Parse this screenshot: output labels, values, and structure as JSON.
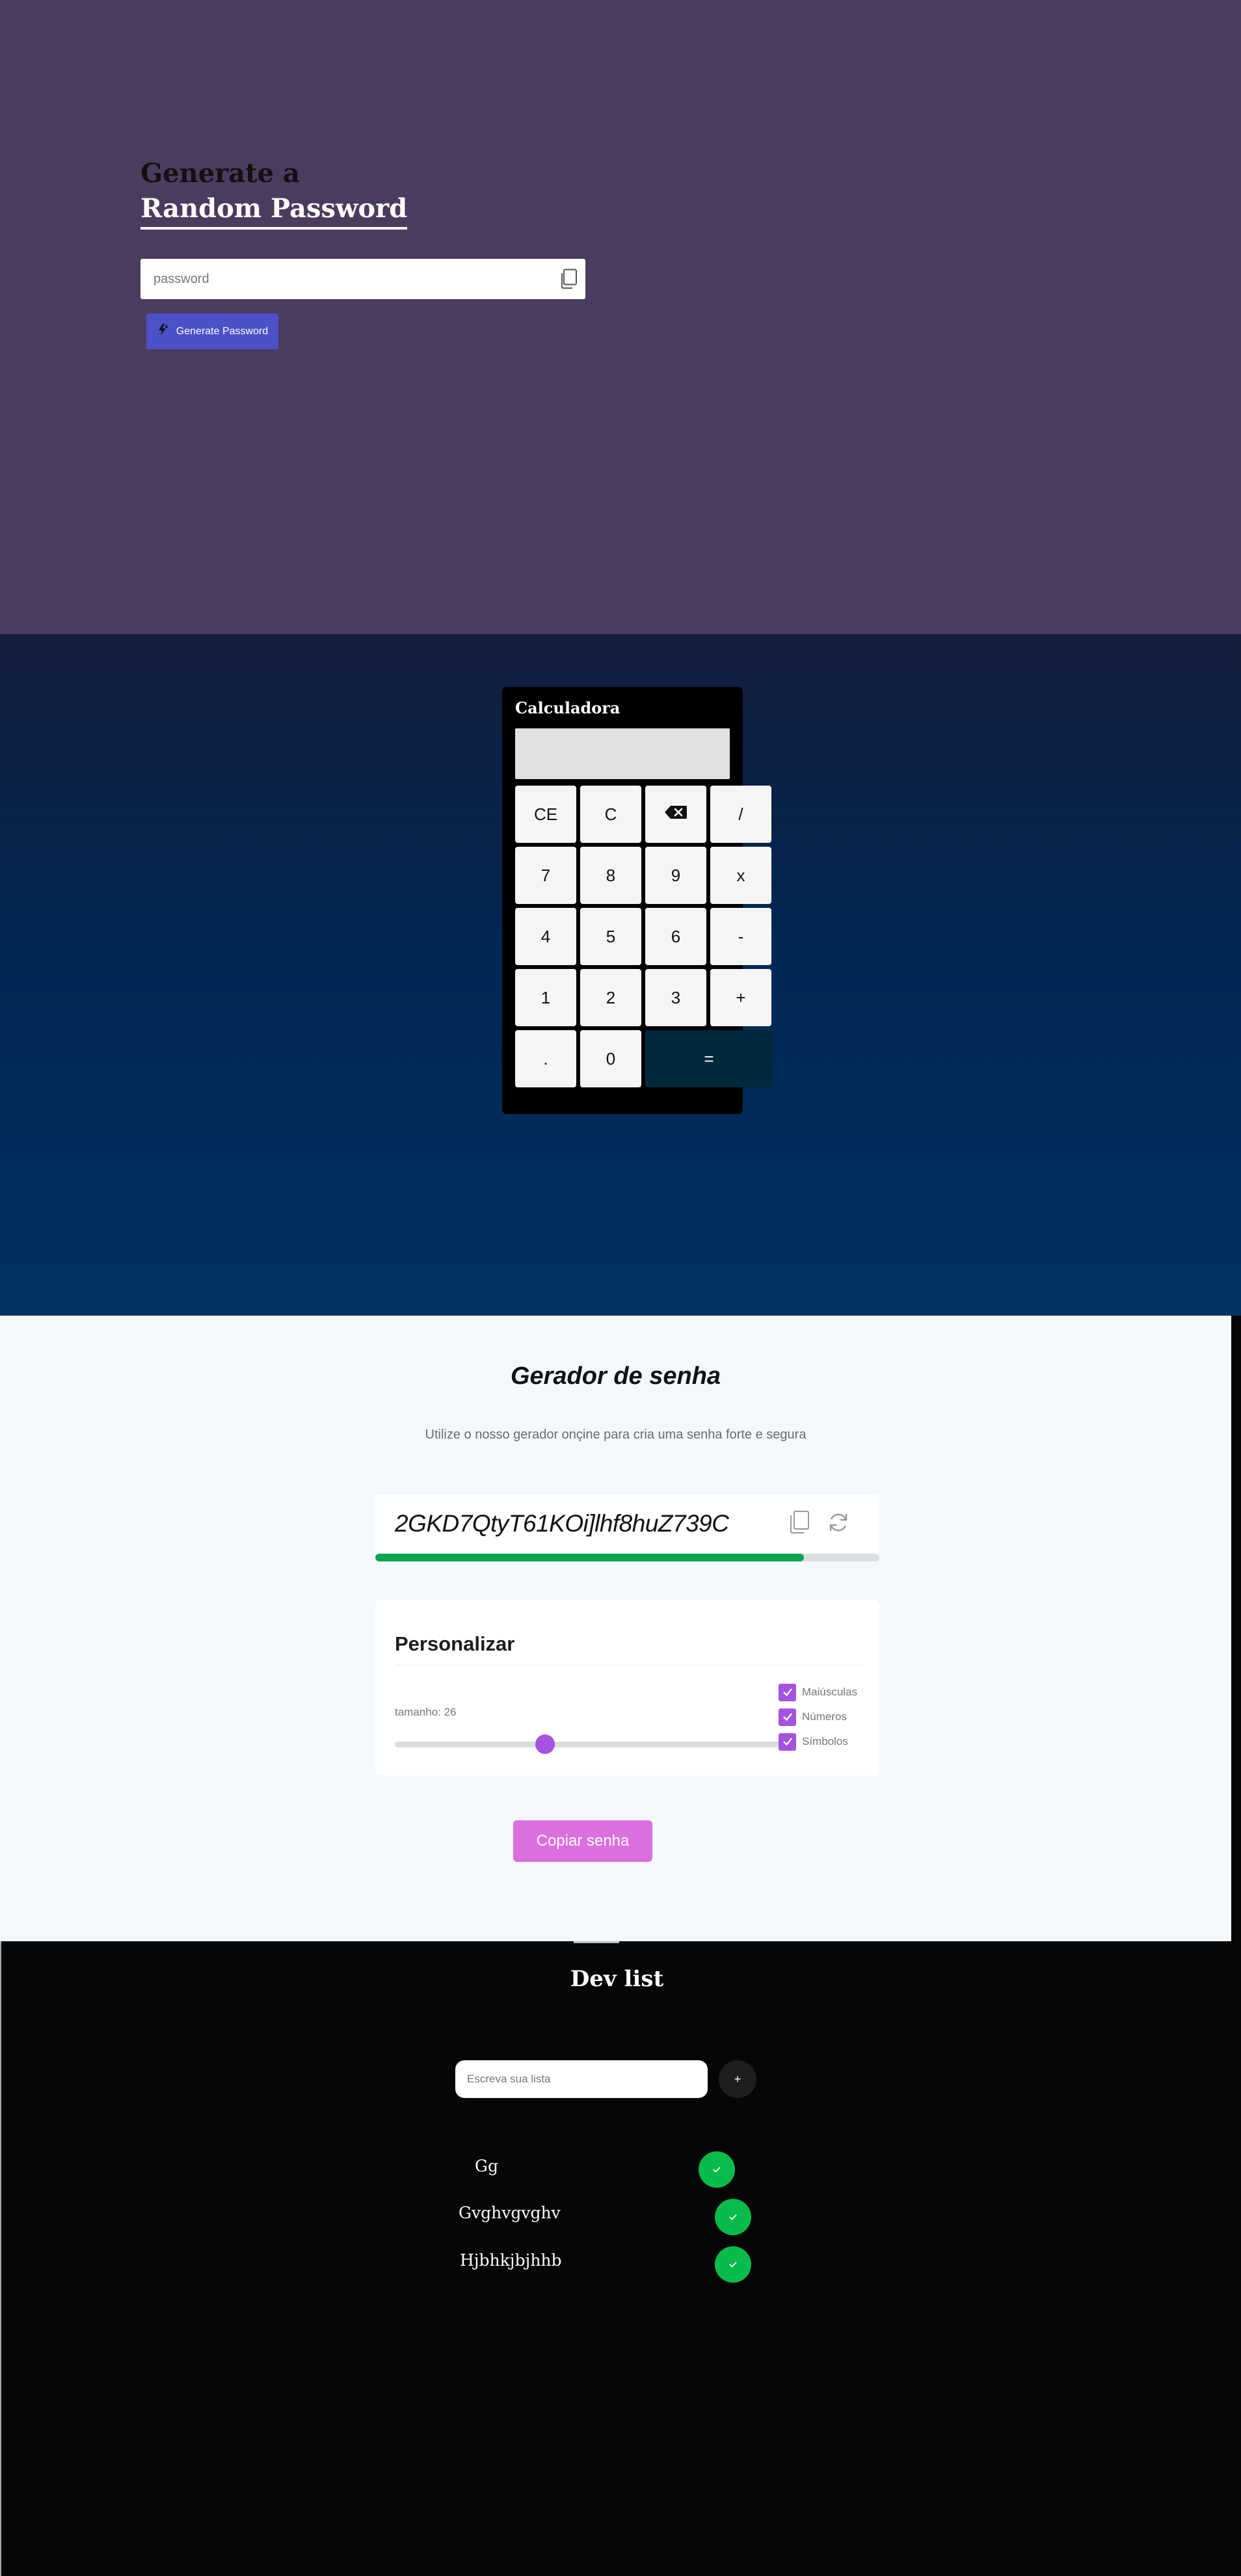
{
  "random_password": {
    "title_line1": "Generate a",
    "title_line2": "Random Password",
    "input_placeholder": "password",
    "input_value": "",
    "generate_button": "Generate Password"
  },
  "calculator": {
    "title": "Calculadora",
    "display": "",
    "keys": [
      "CE",
      "C",
      "⌫",
      "/",
      "7",
      "8",
      "9",
      "x",
      "4",
      "5",
      "6",
      "-",
      "1",
      "2",
      "3",
      "+",
      ".",
      "0",
      "="
    ]
  },
  "generator": {
    "title": "Gerador de senha",
    "subtitle": "Utilize o nosso gerador onçine para cria uma senha forte e segura",
    "password": "2GKD7QtyT61KOi]lhf8huZ739C",
    "strength": 0.85,
    "strength_color": "#0ba552",
    "customize": {
      "title": "Personalizar",
      "length_label": "tamanho: 26",
      "length_fraction": 0.38,
      "options": [
        {
          "label": "Maiúsculas",
          "checked": true
        },
        {
          "label": "Números",
          "checked": true
        },
        {
          "label": "Símbolos",
          "checked": true
        }
      ]
    },
    "copy_button": "Copiar senha",
    "accent_color": "#a552e0"
  },
  "dev_list": {
    "title": "Dev list",
    "input_placeholder": "Escreva sua lista",
    "add_button": "+",
    "items": [
      {
        "text": "Gg"
      },
      {
        "text": "Gvghvgvghv"
      },
      {
        "text": "Hjbhkjbjhhb"
      }
    ],
    "check_color": "#08bb4a"
  }
}
